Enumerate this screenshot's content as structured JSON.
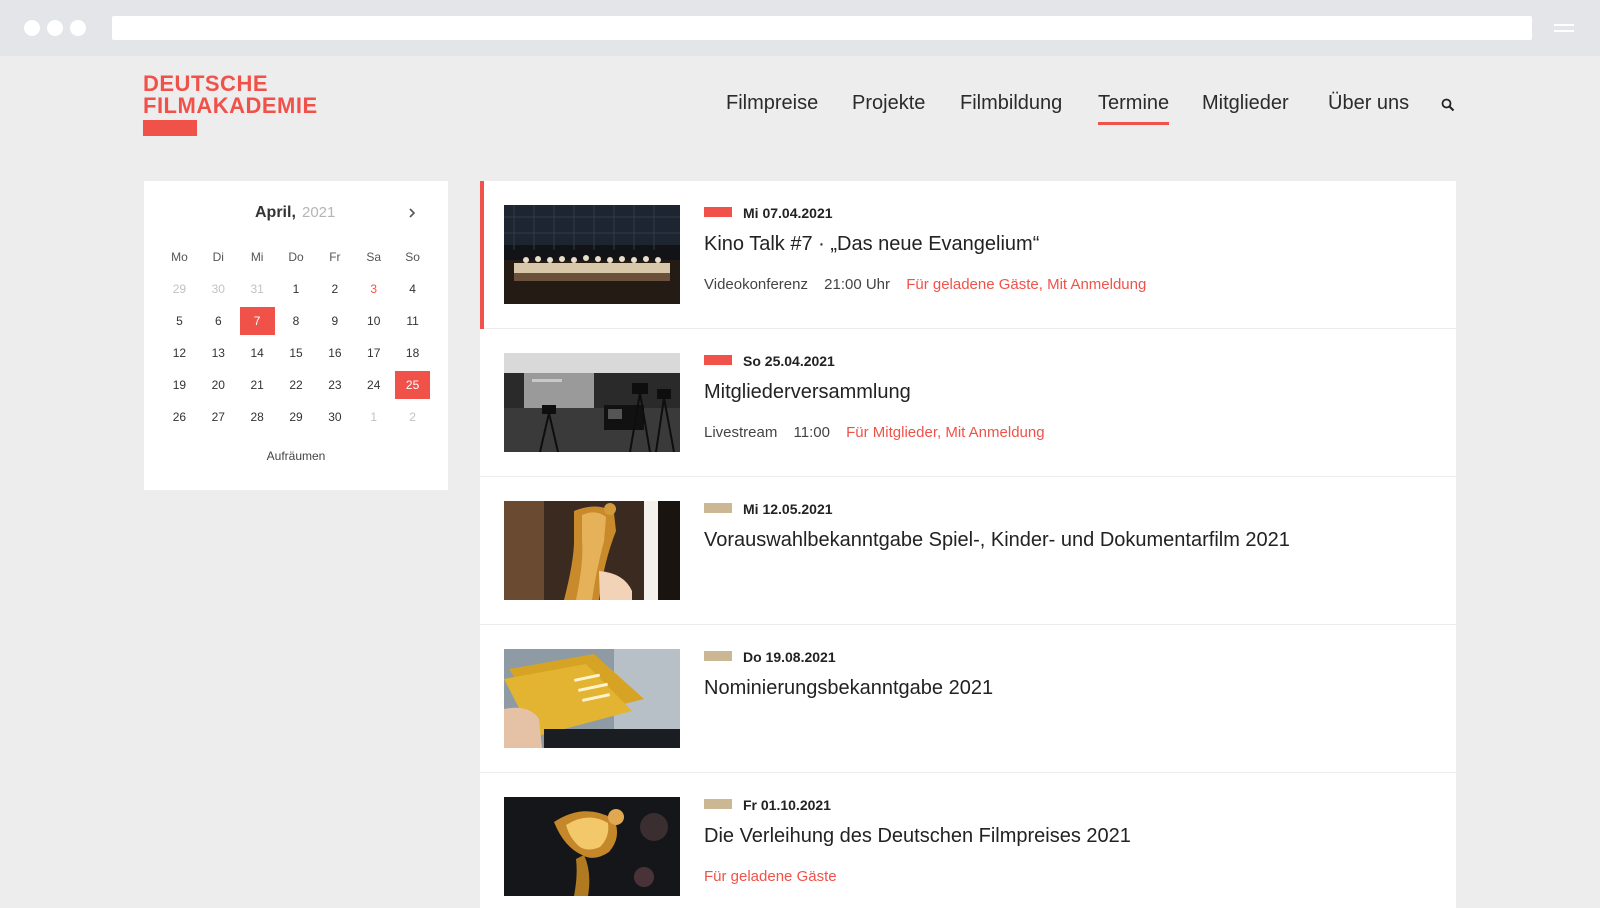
{
  "brand": {
    "line1": "DEUTSCHE",
    "line2": "FILMAKADEMIE",
    "accent_color": "#f0524a",
    "gold_color": "#cbb793"
  },
  "nav": {
    "items": [
      {
        "label": "Filmpreise"
      },
      {
        "label": "Projekte"
      },
      {
        "label": "Filmbildung"
      },
      {
        "label": "Termine",
        "active": true
      },
      {
        "label": "Mitglieder"
      },
      {
        "label": "Über uns"
      }
    ],
    "search_icon": "search-icon"
  },
  "calendar": {
    "month": "April,",
    "year": "2021",
    "next_icon": "chevron-right-icon",
    "weekdays": [
      "Mo",
      "Di",
      "Mi",
      "Do",
      "Fr",
      "Sa",
      "So"
    ],
    "weeks": [
      [
        "29",
        "30",
        "31",
        "1",
        "2",
        "3",
        "4"
      ],
      [
        "5",
        "6",
        "7",
        "8",
        "9",
        "10",
        "11"
      ],
      [
        "12",
        "13",
        "14",
        "15",
        "16",
        "17",
        "18"
      ],
      [
        "19",
        "20",
        "21",
        "22",
        "23",
        "24",
        "25"
      ],
      [
        "26",
        "27",
        "28",
        "29",
        "30",
        "1",
        "2"
      ]
    ],
    "clear_label": "Aufräumen"
  },
  "events": [
    {
      "date": "Mi 07.04.2021",
      "title": "Kino Talk #7 · „Das neue Evangelium“",
      "location": "Videokonferenz",
      "time": "21:00 Uhr",
      "tags": "Für geladene Gäste, Mit Anmeldung",
      "flag_color": "#f0524a"
    },
    {
      "date": "So 25.04.2021",
      "title": "Mitgliederversammlung",
      "location": "Livestream",
      "time": "11:00",
      "tags": "Für Mitglieder, Mit Anmeldung",
      "flag_color": "#f0524a"
    },
    {
      "date": "Mi 12.05.2021",
      "title": "Vorauswahlbekanntgabe Spiel-, Kinder- und Dokumentarfilm 2021",
      "flag_color": "#cbb793"
    },
    {
      "date": "Do 19.08.2021",
      "title": "Nominierungsbekanntgabe 2021",
      "flag_color": "#cbb793"
    },
    {
      "date": "Fr 01.10.2021",
      "title": "Die Verleihung des Deutschen Filmpreises 2021",
      "tags": "Für geladene Gäste",
      "flag_color": "#cbb793"
    }
  ]
}
